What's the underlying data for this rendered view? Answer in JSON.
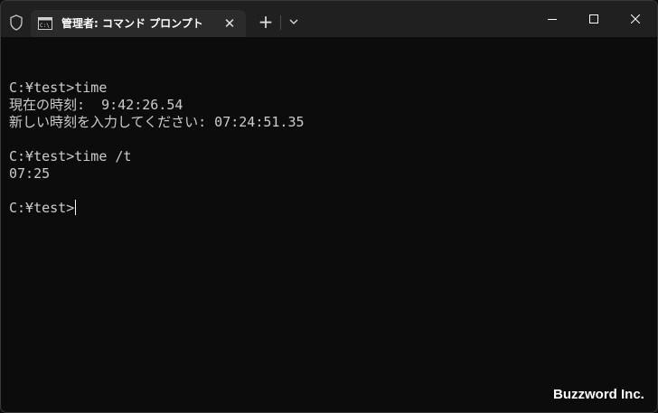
{
  "tab": {
    "title": "管理者: コマンド プロンプト",
    "close_glyph": "✕"
  },
  "tabbar": {
    "new_tab_glyph": "+"
  },
  "terminal": {
    "lines": [
      "",
      "C:¥test>time",
      "現在の時刻:  9:42:26.54",
      "新しい時刻を入力してください: 07:24:51.35",
      "",
      "C:¥test>time /t",
      "07:25",
      "",
      "C:¥test>"
    ]
  },
  "watermark": "Buzzword Inc.",
  "colors": {
    "titlebar": "#202020",
    "tab": "#2b2b2b",
    "terminal_bg": "#0c0c0c",
    "terminal_fg": "#cccccc"
  },
  "icons": {
    "shield": "shield-icon",
    "tab": "cmd-icon",
    "dropdown": "chevron-down-icon",
    "minimize": "minimize-icon",
    "maximize": "maximize-icon",
    "close": "close-icon"
  }
}
